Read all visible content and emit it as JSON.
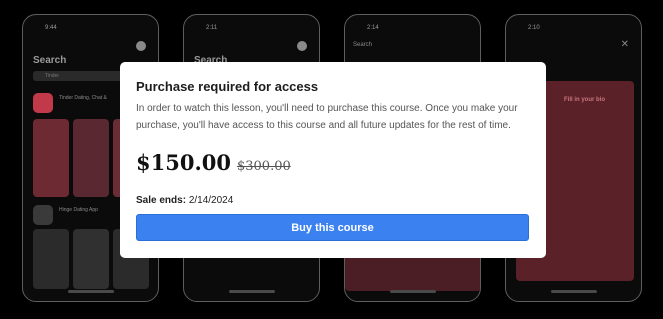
{
  "modal": {
    "title": "Purchase required for access",
    "description": "In order to watch this lesson, you'll need to purchase this course. Once you make your purchase, you'll have access to this course and all future updates for the rest of time.",
    "price": "$150.00",
    "original_price": "$300.00",
    "sale_label": "Sale ends:",
    "sale_date": "2/14/2024",
    "buy_label": "Buy this course"
  },
  "background": {
    "phone1": {
      "time": "9:44",
      "heading": "Search",
      "search_placeholder": "Tinder",
      "app1_title": "Tinder Dating, Chat &",
      "app2_title": "Hinge Dating App"
    },
    "phone2": {
      "time": "2:11",
      "heading": "Search"
    },
    "phone3": {
      "time": "2:14",
      "back_label": "Search"
    },
    "phone4": {
      "time": "2:10",
      "screen_text": "Fill in your bio"
    }
  },
  "colors": {
    "accent": "#3b82f0",
    "overlay_bg": "#000000",
    "modal_bg": "#ffffff"
  }
}
